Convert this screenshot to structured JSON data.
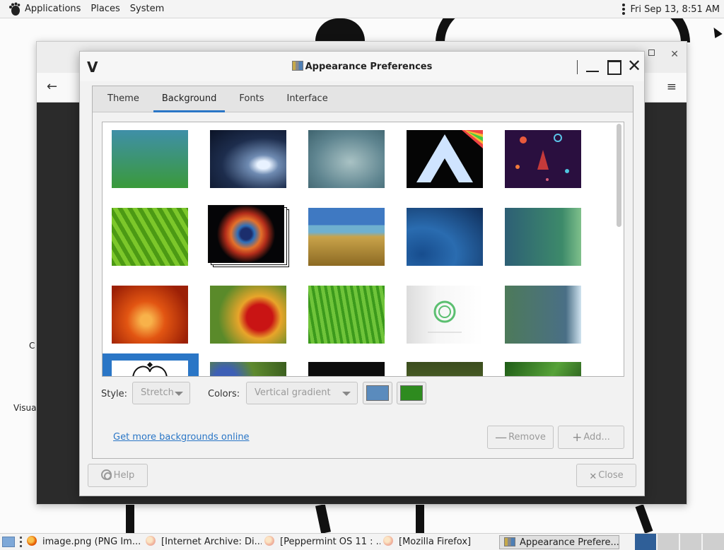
{
  "top_panel": {
    "menus": [
      "Applications",
      "Places",
      "System"
    ],
    "clock": "Fri Sep 13,  8:51 AM"
  },
  "desktop": {
    "labels": [
      "C",
      "Visua"
    ]
  },
  "dialog": {
    "logo": "V",
    "title": "Appearance Preferences",
    "tabs": [
      "Theme",
      "Background",
      "Fonts",
      "Interface"
    ],
    "active_tab": "Background",
    "wallpapers": [
      "green-gradient",
      "water-drop",
      "blue-haze",
      "rainbow-arch",
      "space-rocket",
      "green-leaf",
      "helix-nebula",
      "seaside-grass",
      "blue-waves",
      "teal-bubbles",
      "orange-flower",
      "red-flower",
      "green-grass",
      "peppermint-logo",
      "slate-gradient",
      "artipower-selected",
      "blue-flowers",
      "dark-stars",
      "olive-field",
      "green-leaves"
    ],
    "style_label": "Style:",
    "style_value": "Stretch",
    "colors_label": "Colors:",
    "colors_value": "Vertical gradient",
    "primary_color": "#5a8bbd",
    "secondary_color": "#2e8b1f",
    "more_link": "Get more backgrounds online",
    "remove_label": "Remove",
    "add_label": "Add...",
    "help_label": "Help",
    "close_label": "Close"
  },
  "taskbar": {
    "tasks": [
      "image.png (PNG Im...",
      "[Internet Archive: Di...",
      "[Peppermint OS 11 : ...",
      "[Mozilla Firefox]",
      "Appearance Prefere..."
    ]
  },
  "colors": {
    "accent": "#2a76c6",
    "panel": "#f4f4f4"
  }
}
